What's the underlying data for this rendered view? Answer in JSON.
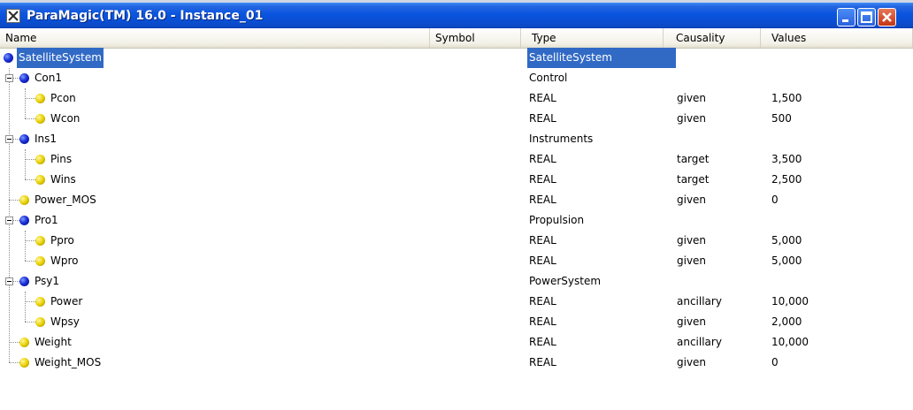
{
  "window": {
    "title": "ParaMagic(TM) 16.0 - Instance_01"
  },
  "columns": {
    "name": "Name",
    "symbol": "Symbol",
    "type": "Type",
    "causality": "Causality",
    "values": "Values"
  },
  "rows": [
    {
      "name": "SatelliteSystem",
      "type": "SatelliteSystem",
      "causality": "",
      "value": "",
      "icon": "blue-ball-icon",
      "selected": true
    },
    {
      "name": "Con1",
      "type": "Control",
      "causality": "",
      "value": "",
      "icon": "blue-ball-icon"
    },
    {
      "name": "Pcon",
      "type": "REAL",
      "causality": "given",
      "value": "1,500",
      "icon": "yellow-ball-icon"
    },
    {
      "name": "Wcon",
      "type": "REAL",
      "causality": "given",
      "value": "500",
      "icon": "yellow-ball-icon"
    },
    {
      "name": "Ins1",
      "type": "Instruments",
      "causality": "",
      "value": "",
      "icon": "blue-ball-icon"
    },
    {
      "name": "Pins",
      "type": "REAL",
      "causality": "target",
      "value": "3,500",
      "icon": "yellow-ball-icon"
    },
    {
      "name": "Wins",
      "type": "REAL",
      "causality": "target",
      "value": "2,500",
      "icon": "yellow-ball-icon"
    },
    {
      "name": "Power_MOS",
      "type": "REAL",
      "causality": "given",
      "value": "0",
      "icon": "yellow-ball-icon"
    },
    {
      "name": "Pro1",
      "type": "Propulsion",
      "causality": "",
      "value": "",
      "icon": "blue-ball-icon"
    },
    {
      "name": "Ppro",
      "type": "REAL",
      "causality": "given",
      "value": "5,000",
      "icon": "yellow-ball-icon"
    },
    {
      "name": "Wpro",
      "type": "REAL",
      "causality": "given",
      "value": "5,000",
      "icon": "yellow-ball-icon"
    },
    {
      "name": "Psy1",
      "type": "PowerSystem",
      "causality": "",
      "value": "",
      "icon": "blue-ball-icon"
    },
    {
      "name": "Power",
      "type": "REAL",
      "causality": "ancillary",
      "value": "10,000",
      "icon": "yellow-ball-icon"
    },
    {
      "name": "Wpsy",
      "type": "REAL",
      "causality": "given",
      "value": "2,000",
      "icon": "yellow-ball-icon"
    },
    {
      "name": "Weight",
      "type": "REAL",
      "causality": "ancillary",
      "value": "10,000",
      "icon": "yellow-ball-icon"
    },
    {
      "name": "Weight_MOS",
      "type": "REAL",
      "causality": "given",
      "value": "0",
      "icon": "yellow-ball-icon"
    }
  ],
  "colors": {
    "titlebar": "#0a55df",
    "selection": "#316ac5",
    "header_bg": "#ece9d8"
  }
}
